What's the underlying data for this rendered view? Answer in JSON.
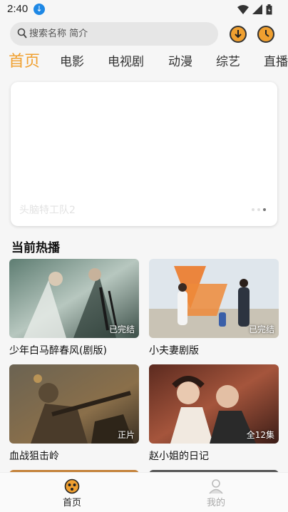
{
  "status_bar": {
    "time": "2:40"
  },
  "search": {
    "placeholder": "搜索名称 简介"
  },
  "tabs": [
    {
      "label": "首页",
      "active": true
    },
    {
      "label": "电影",
      "active": false
    },
    {
      "label": "电视剧",
      "active": false
    },
    {
      "label": "动漫",
      "active": false
    },
    {
      "label": "综艺",
      "active": false
    },
    {
      "label": "直播",
      "active": false
    }
  ],
  "banner": {
    "title": "头脑特工队2",
    "dots": 3,
    "active_dot": 3
  },
  "section": {
    "title": "当前热播"
  },
  "cards": [
    {
      "title": "少年白马醉春风(剧版)",
      "badge": "已完结"
    },
    {
      "title": "小夫妻剧版",
      "badge": "已完结"
    },
    {
      "title": "血战狙击岭",
      "badge": "正片"
    },
    {
      "title": "赵小姐的日记",
      "badge": "全12集"
    }
  ],
  "nav": [
    {
      "label": "首页",
      "icon": "home-icon",
      "active": true
    },
    {
      "label": "我的",
      "icon": "profile-icon",
      "active": false
    }
  ],
  "colors": {
    "accent": "#f0a030",
    "background": "#f6f6f6"
  }
}
